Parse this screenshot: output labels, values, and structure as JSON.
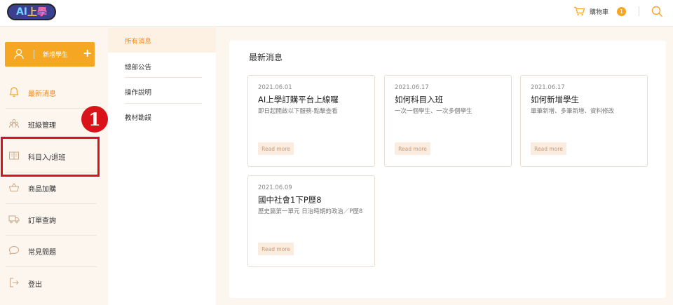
{
  "header": {
    "logo": {
      "part1": "AI",
      "part2": "上",
      "part3": "學"
    },
    "cart_label": "購物車",
    "cart_count": "1",
    "search_icon": "search-icon"
  },
  "sidebar": {
    "add_student_label": "新增學生",
    "add_student_plus": "+",
    "items": [
      {
        "label": "最新消息",
        "icon": "bell-icon",
        "active": true
      },
      {
        "label": "班級管理",
        "icon": "group-icon",
        "active": false
      },
      {
        "label": "科目入/退班",
        "icon": "book-icon",
        "active": false
      },
      {
        "label": "商品加購",
        "icon": "basket-icon",
        "active": false
      },
      {
        "label": "訂單查詢",
        "icon": "truck-icon",
        "active": false
      },
      {
        "label": "常見問題",
        "icon": "chat-icon",
        "active": false
      },
      {
        "label": "登出",
        "icon": "logout-icon",
        "active": false
      }
    ],
    "step_marker": "1",
    "accent": "#f5a623",
    "highlight_color": "#d8141a"
  },
  "submenu": {
    "items": [
      {
        "label": "所有消息",
        "active": true
      },
      {
        "label": "總部公告",
        "active": false
      },
      {
        "label": "操作說明",
        "active": false
      },
      {
        "label": "教材勘誤",
        "active": false
      }
    ]
  },
  "main": {
    "title": "最新消息",
    "cards": [
      {
        "date": "2021.06.01",
        "title": "AI上學訂購平台上線囉",
        "desc": "即日起開啟以下服務-點擊查看",
        "more": "Read more"
      },
      {
        "date": "2021.06.17",
        "title": "如何科目入班",
        "desc": "一次一個學生、一次多個學生",
        "more": "Read more"
      },
      {
        "date": "2021.06.17",
        "title": "如何新增學生",
        "desc": "單筆新增、多筆新增、資料修改",
        "more": "Read more"
      },
      {
        "date": "2021.06.09",
        "title": "國中社會1下P歷8",
        "desc": "歷史篇第一單元 日治時期的政治／P歷8",
        "more": "Read more"
      }
    ]
  }
}
